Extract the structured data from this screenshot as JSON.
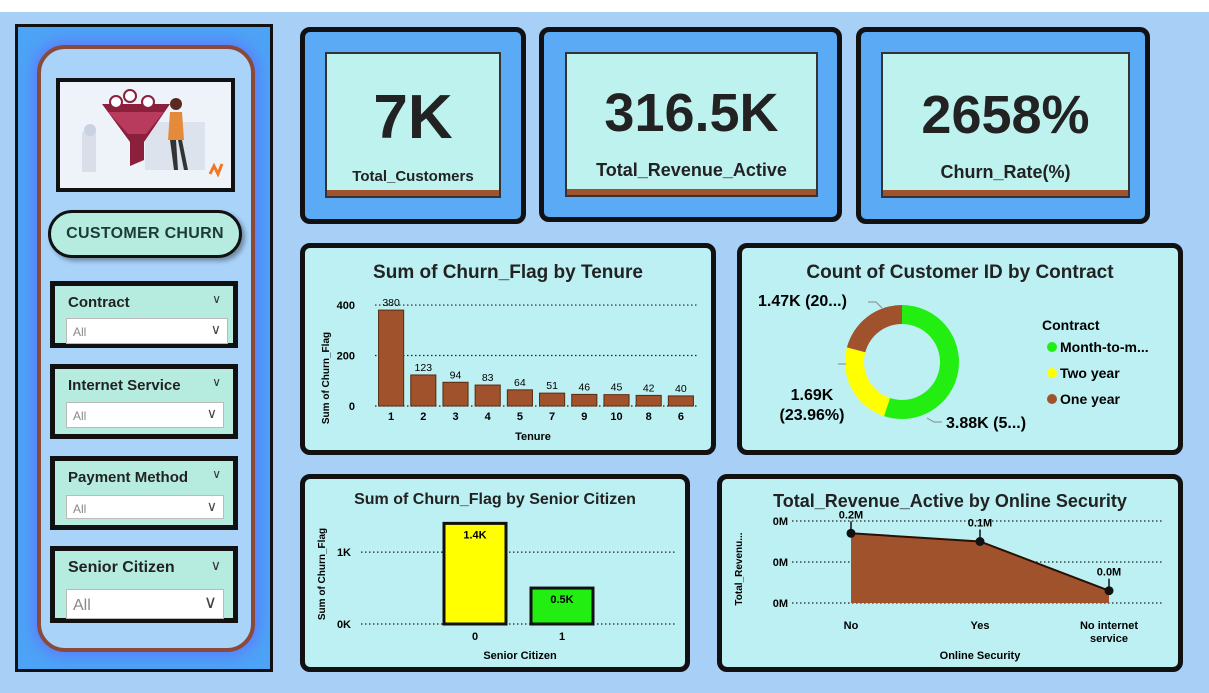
{
  "sidebar": {
    "title": "CUSTOMER CHURN",
    "filters": [
      {
        "label": "Contract",
        "value": "All"
      },
      {
        "label": "Internet Service",
        "value": "All"
      },
      {
        "label": "Payment Method",
        "value": "All"
      },
      {
        "label": "Senior Citizen",
        "value": "All"
      }
    ]
  },
  "kpis": [
    {
      "value": "7K",
      "label": "Total_Customers"
    },
    {
      "value": "316.5K",
      "label": "Total_Revenue_Active"
    },
    {
      "value": "2658%",
      "label": "Churn_Rate(%)"
    }
  ],
  "colors": {
    "brown": "#a0522d",
    "green": "#22ee11",
    "yellow": "#ffff00",
    "card": "#bdf0f2",
    "kpi_bg": "#bdf2ef",
    "accent_blue": "#4da3f5"
  },
  "chart_data": [
    {
      "type": "bar",
      "title": "Sum of Churn_Flag by Tenure",
      "xlabel": "Tenure",
      "ylabel": "Sum of Churn_Flag",
      "categories": [
        "1",
        "2",
        "3",
        "4",
        "5",
        "7",
        "9",
        "10",
        "8",
        "6"
      ],
      "values": [
        380,
        123,
        94,
        83,
        64,
        51,
        46,
        45,
        42,
        40
      ],
      "ylim": [
        0,
        420
      ],
      "yticks": [
        "0",
        "200",
        "400"
      ],
      "bar_color": "#a0522d"
    },
    {
      "type": "pie",
      "title": "Count of Customer ID by Contract",
      "legend_title": "Contract",
      "categories": [
        "Month-to-m...",
        "Two year",
        "One year"
      ],
      "values": [
        3880,
        1690,
        1470
      ],
      "colors": [
        "#22ee11",
        "#ffff00",
        "#a0522d"
      ],
      "data_labels": [
        "3.88K (5...)",
        "1.69K (23.96%)",
        "1.47K (20...)"
      ],
      "legend_placement": "right"
    },
    {
      "type": "bar",
      "title": "Sum of Churn_Flag by Senior Citizen",
      "xlabel": "Senior Citizen",
      "ylabel": "Sum of Churn_Flag",
      "categories": [
        "0",
        "1"
      ],
      "values": [
        1400,
        500
      ],
      "data_labels": [
        "1.4K",
        "0.5K"
      ],
      "colors": [
        "#ffff00",
        "#22ee11"
      ],
      "yticks": [
        "0K",
        "1K"
      ],
      "ylim": [
        0,
        1600
      ]
    },
    {
      "type": "area",
      "title": "Total_Revenue_Active by Online Security",
      "xlabel": "Online Security",
      "ylabel": "Total_Revenu...",
      "categories": [
        "No",
        "Yes",
        "No internet service"
      ],
      "values": [
        0.17,
        0.15,
        0.03
      ],
      "data_labels": [
        "0.2M",
        "0.1M",
        "0.0M"
      ],
      "yticks": [
        "0M",
        "0M",
        "0M"
      ],
      "ylim": [
        0,
        0.2
      ],
      "fill_color": "#a0522d"
    }
  ]
}
